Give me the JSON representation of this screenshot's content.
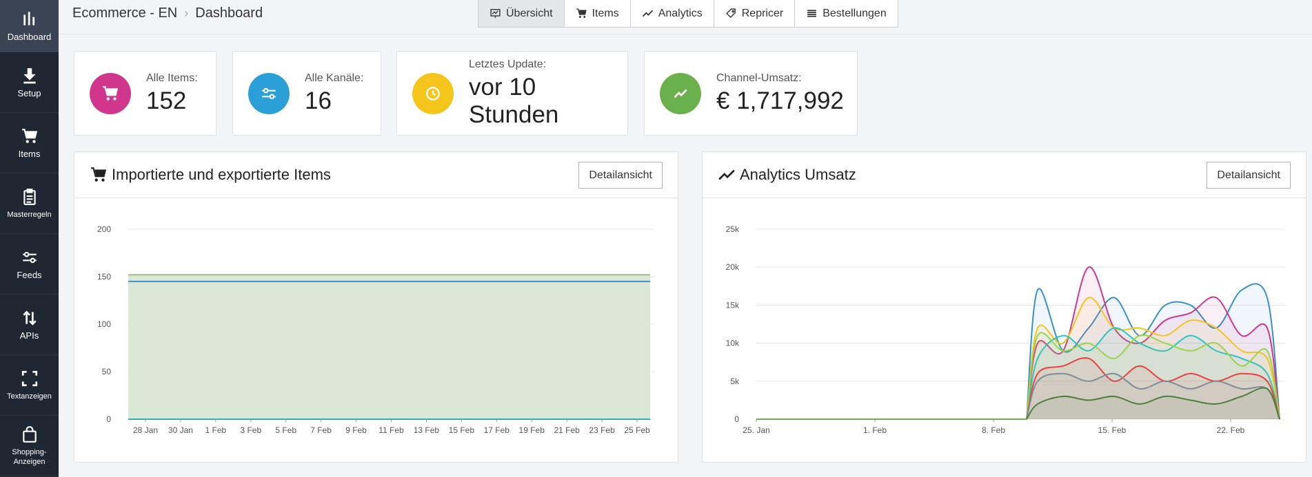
{
  "sidebar": {
    "items": [
      {
        "label": "Dashboard",
        "icon": "bar-chart-icon"
      },
      {
        "label": "Setup",
        "icon": "download-icon"
      },
      {
        "label": "Items",
        "icon": "cart-icon"
      },
      {
        "label": "Masterregeln",
        "icon": "clipboard-icon"
      },
      {
        "label": "Feeds",
        "icon": "sliders-icon"
      },
      {
        "label": "APIs",
        "icon": "arrows-updown-icon"
      },
      {
        "label": "Textanzeigen",
        "icon": "fullscreen-icon"
      },
      {
        "label": "Shopping-Anzeigen",
        "icon": "shopping-bag-icon"
      }
    ]
  },
  "breadcrumb": {
    "project": "Ecommerce - EN",
    "page": "Dashboard"
  },
  "nav": {
    "tabs": [
      {
        "label": "Übersicht",
        "icon": "presentation-chart-icon"
      },
      {
        "label": "Items",
        "icon": "cart-icon"
      },
      {
        "label": "Analytics",
        "icon": "trend-icon"
      },
      {
        "label": "Repricer",
        "icon": "tag-icon"
      },
      {
        "label": "Bestellungen",
        "icon": "list-icon"
      }
    ]
  },
  "kpis": [
    {
      "label": "Alle Items:",
      "value": "152",
      "color": "#d0378c",
      "icon": "cart-icon"
    },
    {
      "label": "Alle Kanäle:",
      "value": "16",
      "color": "#2a9fd8",
      "icon": "sliders-icon"
    },
    {
      "label": "Letztes Update:",
      "value": "vor 10 Stunden",
      "color": "#f5c51b",
      "icon": "clock-icon"
    },
    {
      "label": "Channel-Umsatz:",
      "value": "€ 1,717,992",
      "color": "#6ab04c",
      "icon": "trend-icon"
    }
  ],
  "panels": {
    "items": {
      "title": "Importierte und exportierte Items",
      "button": "Detailansicht"
    },
    "analytics": {
      "title": "Analytics Umsatz",
      "button": "Detailansicht"
    }
  },
  "chart_data": [
    {
      "type": "area",
      "ylim": [
        0,
        200
      ],
      "yticks": [
        "0",
        "50",
        "100",
        "150",
        "200"
      ],
      "xticks": [
        "28 Jan",
        "30 Jan",
        "1 Feb",
        "3 Feb",
        "5 Feb",
        "7 Feb",
        "9 Feb",
        "11 Feb",
        "13 Feb",
        "15 Feb",
        "17 Feb",
        "19 Feb",
        "21 Feb",
        "23 Feb",
        "25 Feb"
      ],
      "series": [
        {
          "values": [
            152,
            152
          ],
          "color": "#9dbf8a"
        },
        {
          "values": [
            145,
            145
          ],
          "color": "#3a8fc9"
        },
        {
          "values": [
            0,
            0
          ],
          "color": "#2bb3b3"
        }
      ],
      "grid": true
    },
    {
      "type": "area",
      "ylim": [
        0,
        25000
      ],
      "yticks": [
        "0",
        "5k",
        "10k",
        "15k",
        "20k",
        "25k"
      ],
      "xticks": [
        "25. Jan",
        "1. Feb",
        "8. Feb",
        "15. Feb",
        "22. Feb"
      ],
      "grid": true,
      "series": [
        {
          "color": "#3a8fc9",
          "values": [
            17000,
            9000,
            12000,
            16000,
            11000,
            15000,
            15000,
            12000,
            17000,
            16000
          ]
        },
        {
          "color": "#d0378c",
          "values": [
            10000,
            9000,
            20000,
            12000,
            10000,
            13000,
            14000,
            16000,
            11000,
            12000
          ]
        },
        {
          "color": "#f5c51b",
          "values": [
            12000,
            10000,
            16000,
            12000,
            12000,
            11000,
            13000,
            12000,
            9000,
            8000
          ]
        },
        {
          "color": "#2bc2c2",
          "values": [
            8000,
            11000,
            9000,
            12000,
            10000,
            9000,
            11000,
            9000,
            8000,
            6000
          ]
        },
        {
          "color": "#9bd24a",
          "values": [
            11000,
            9000,
            10000,
            8000,
            11000,
            10000,
            9000,
            10000,
            7000,
            9000
          ]
        },
        {
          "color": "#e8413e",
          "values": [
            6000,
            7000,
            8000,
            5000,
            7000,
            5000,
            6000,
            5000,
            6000,
            5000
          ]
        },
        {
          "color": "#7f8c98",
          "values": [
            5000,
            6000,
            5000,
            6000,
            4000,
            5000,
            4000,
            5000,
            4000,
            4000
          ]
        },
        {
          "color": "#4e7f3a",
          "values": [
            2000,
            3000,
            2500,
            3000,
            2000,
            3000,
            2500,
            2000,
            3000,
            4000
          ]
        }
      ]
    }
  ]
}
